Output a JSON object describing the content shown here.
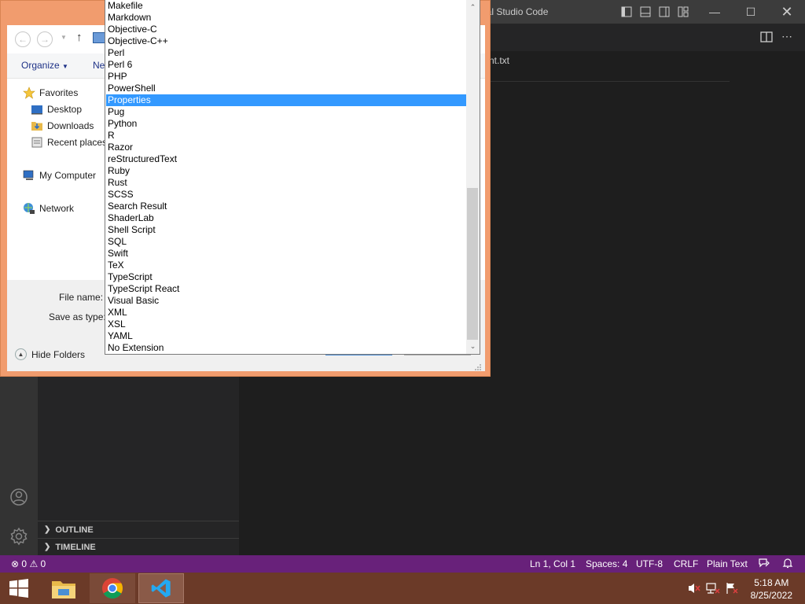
{
  "vscode": {
    "window_title": "ual Studio Code",
    "tab_text": "nt.txt",
    "sidebar_sections": [
      {
        "label": "OUTLINE"
      },
      {
        "label": "TIMELINE"
      }
    ],
    "status": {
      "errors": "0",
      "warnings": "0",
      "position": "Ln 1, Col 1",
      "spaces": "Spaces: 4",
      "encoding": "UTF-8",
      "eol": "CRLF",
      "language": "Plain Text"
    }
  },
  "dialog": {
    "toolbar": {
      "organize": "Organize",
      "new_folder": "Ne"
    },
    "tree": {
      "favorites": "Favorites",
      "desktop": "Desktop",
      "downloads": "Downloads",
      "recent": "Recent places",
      "computer": "My Computer",
      "network": "Network"
    },
    "file_name_label": "File name:",
    "save_type_label": "Save as type:",
    "hide_folders": "Hide Folders"
  },
  "dropdown": {
    "selected_index": 8,
    "items": [
      "Makefile",
      "Markdown",
      "Objective-C",
      "Objective-C++",
      "Perl",
      "Perl 6",
      "PHP",
      "PowerShell",
      "Properties",
      "Pug",
      "Python",
      "R",
      "Razor",
      "reStructuredText",
      "Ruby",
      "Rust",
      "SCSS",
      "Search Result",
      "ShaderLab",
      "Shell Script",
      "SQL",
      "Swift",
      "TeX",
      "TypeScript",
      "TypeScript React",
      "Visual Basic",
      "XML",
      "XSL",
      "YAML",
      "No Extension"
    ]
  },
  "taskbar": {
    "time": "5:18 AM",
    "date": "8/25/2022",
    "apps": [
      "file-explorer",
      "chrome",
      "vscode"
    ]
  },
  "colors": {
    "statusbar": "#68217a",
    "dialog_frame": "#f19c6e",
    "taskbar": "#6b3a28",
    "selection": "#3399ff"
  }
}
